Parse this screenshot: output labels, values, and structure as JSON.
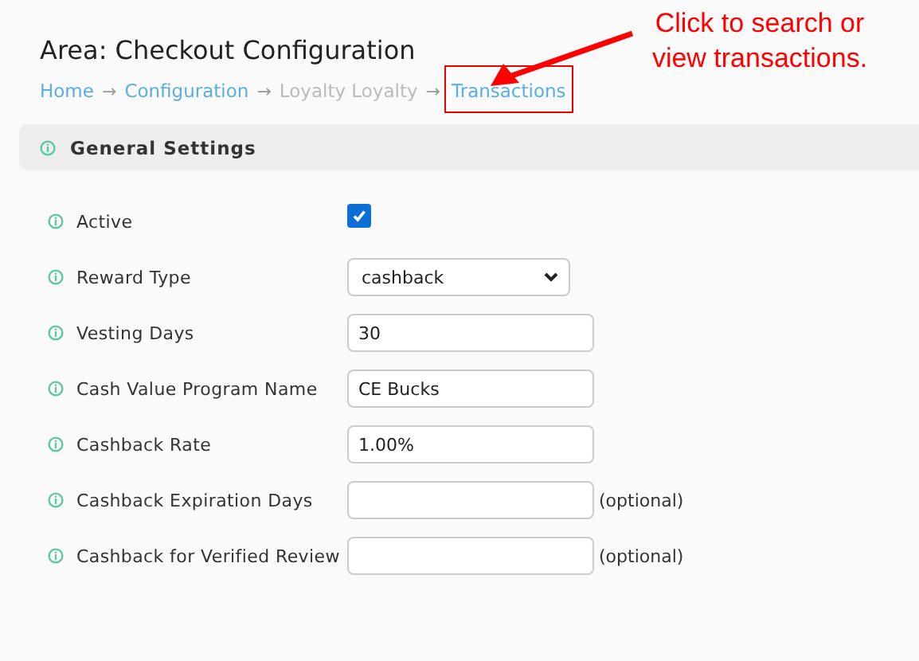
{
  "page_title": "Area: Checkout Configuration",
  "breadcrumb": [
    {
      "label": "Home",
      "kind": "link",
      "highlighted": false
    },
    {
      "label": "Configuration",
      "kind": "link",
      "highlighted": false
    },
    {
      "label": "Loyalty Loyalty",
      "kind": "current",
      "highlighted": false
    },
    {
      "label": "Transactions",
      "kind": "link",
      "highlighted": true
    }
  ],
  "separator": "→",
  "annotation": {
    "text": "Click to search or view transactions."
  },
  "section": {
    "title": "General Settings"
  },
  "fields": [
    {
      "label": "Active",
      "kind": "checkbox",
      "checked": true
    },
    {
      "label": "Reward Type",
      "kind": "select",
      "value": "cashback"
    },
    {
      "label": "Vesting Days",
      "kind": "text",
      "value": "30"
    },
    {
      "label": "Cash Value Program Name",
      "kind": "text",
      "value": "CE Bucks"
    },
    {
      "label": "Cashback Rate",
      "kind": "text",
      "value": "1.00%"
    },
    {
      "label": "Cashback Expiration Days",
      "kind": "text",
      "note": "(optional)"
    },
    {
      "label": "Cashback for Verified Review",
      "kind": "text",
      "note": "(optional)"
    }
  ]
}
